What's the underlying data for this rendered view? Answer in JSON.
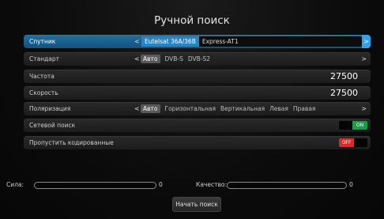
{
  "title": "Ручной поиск",
  "satellite": {
    "label": "Спутник",
    "selected": "Eutelsat 36A/36B",
    "next": "Express-AT1",
    "arrow_left": "<",
    "arrow_right": ">"
  },
  "standard": {
    "label": "Стандарт",
    "options": [
      "Авто",
      "DVB-S",
      "DVB-S2"
    ],
    "arrow_left": "<",
    "arrow_right": ">"
  },
  "frequency": {
    "label": "Частота",
    "value": "27500"
  },
  "rate": {
    "label": "Скорость",
    "value": "27500"
  },
  "polarization": {
    "label": "Поляризация",
    "options": [
      "Авто",
      "Горизонтальная",
      "Вертикальная",
      "Левая",
      "Правая"
    ],
    "arrow_left": "<",
    "arrow_right": ">"
  },
  "network_search": {
    "label": "Сетевой поиск",
    "state": "ON"
  },
  "skip_encrypted": {
    "label": "Пропустить кодированные",
    "state": "OFF"
  },
  "signal": {
    "label": "Сила:",
    "value": "0"
  },
  "quality": {
    "label": "Качество:",
    "value": "0"
  },
  "start_button": "Начать поиск",
  "colors": {
    "accent": "#1f6fa5",
    "on": "#1e9a48",
    "off": "#d52b2b"
  }
}
